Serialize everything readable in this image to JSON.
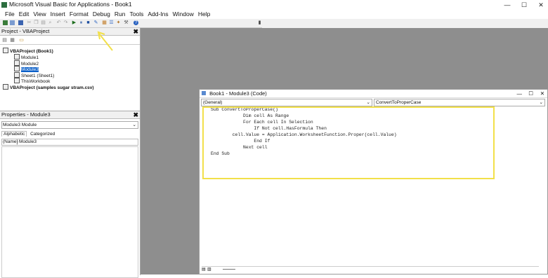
{
  "window": {
    "title": "Microsoft Visual Basic for Applications - Book1"
  },
  "menu": [
    "File",
    "Edit",
    "View",
    "Insert",
    "Format",
    "Debug",
    "Run",
    "Tools",
    "Add-Ins",
    "Window",
    "Help"
  ],
  "project": {
    "title": "Project - VBAProject",
    "tree": [
      "VBAProject (Book1)",
      "Module1",
      "Module2",
      "Module3",
      "Sheet1 (Sheet1)",
      "ThisWorkbook",
      "VBAProject (samples sugar stram.csv)"
    ]
  },
  "properties": {
    "title": "Properties - Module3",
    "object_select": "Module3 Module",
    "tabs": [
      "Alphabetic",
      "Categorized"
    ],
    "row": {
      "name": "(Name)",
      "value": "Module3"
    }
  },
  "codewindow": {
    "title": "Book1 - Module3 (Code)",
    "left_combo": "(General)",
    "right_combo": "ConvertToProperCase",
    "code": "Sub ConvertToProperCase()\n            Dim cell As Range\n            For Each cell In Selection\n                If Not cell.HasFormula Then\n        cell.Value = Application.WorksheetFunction.Proper(cell.Value)\n                End If\n            Next cell\nEnd Sub"
  },
  "colors": {
    "highlight": "#f2e04a",
    "arrow": "#f2e04a",
    "workspace": "#8e8e8e"
  }
}
